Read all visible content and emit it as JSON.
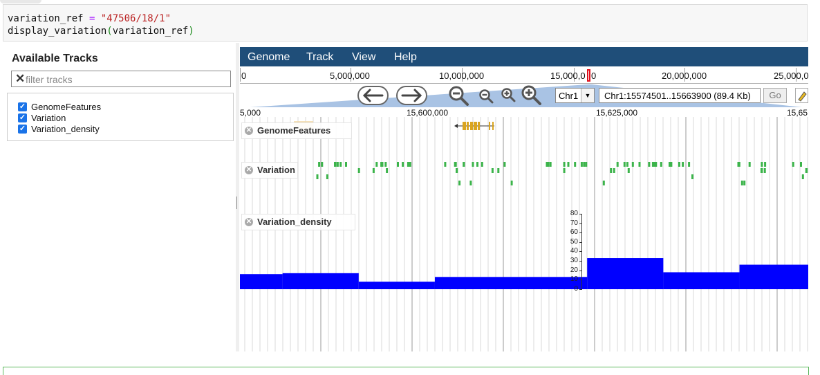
{
  "code": {
    "line1_var": "variation_ref",
    "line1_op": " = ",
    "line1_str": "\"47506/18/1\"",
    "line2_fn": "display_variation",
    "line2_open": "(",
    "line2_arg": "variation_ref",
    "line2_close": ")"
  },
  "sidebar": {
    "title": "Available Tracks",
    "filter_placeholder": "filter tracks",
    "filter_icon": "x-icon",
    "tracks": [
      {
        "label": "GenomeFeatures",
        "checked": true
      },
      {
        "label": "Variation",
        "checked": true
      },
      {
        "label": "Variation_density",
        "checked": true
      }
    ]
  },
  "menu": {
    "items": [
      "Genome",
      "Track",
      "View",
      "Help"
    ],
    "color": "#1f4e79"
  },
  "overview": {
    "ticks": [
      "0",
      "5,000,000",
      "10,000,000",
      "15,000,0",
      "0",
      "20,000,000",
      "25,000,0"
    ]
  },
  "nav": {
    "back_icon": "arrow-left-icon",
    "forward_icon": "arrow-right-icon",
    "zoom_icons": [
      "zoom-out-big-icon",
      "zoom-out-icon",
      "zoom-in-icon",
      "zoom-in-big-icon"
    ],
    "chromosome": "Chr1",
    "location": "Chr1:15574501..15663900 (89.4 Kb)",
    "go_label": "Go"
  },
  "ruler": {
    "ticks": [
      "5,000",
      "15,600,000",
      "15,625,000",
      "15,65"
    ]
  },
  "tracks": {
    "labels": [
      "GenomeFeatures",
      "Variation",
      "Variation_density"
    ],
    "density_axis": [
      "80",
      "70",
      "60",
      "50",
      "40",
      "30",
      "20",
      "10",
      "0"
    ],
    "density_ymax": 80,
    "density_segments": [
      {
        "start": 0,
        "end": 0.075,
        "value": 16
      },
      {
        "start": 0.075,
        "end": 0.209,
        "value": 17
      },
      {
        "start": 0.209,
        "end": 0.343,
        "value": 8
      },
      {
        "start": 0.343,
        "end": 0.611,
        "value": 13
      },
      {
        "start": 0.611,
        "end": 0.745,
        "value": 33
      },
      {
        "start": 0.745,
        "end": 0.879,
        "value": 18
      },
      {
        "start": 0.879,
        "end": 1,
        "value": 26
      }
    ],
    "feature_color": "#daa520",
    "variation_color": "#3cb44b",
    "density_color": "#0000ff"
  }
}
